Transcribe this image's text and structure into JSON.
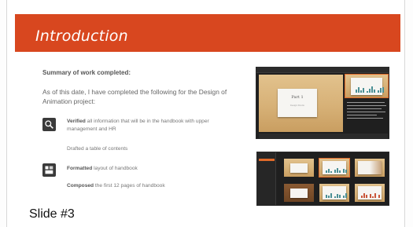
{
  "slide": {
    "title": "Introduction",
    "summary_heading": "Summary of work completed:",
    "intro": "As of this date, I have completed the following for the Design of Animation project:",
    "items": [
      {
        "bold": "Verified",
        "rest": " all information that will be in the handbook with upper management and HR",
        "icon": "search-icon"
      },
      {
        "bold": "",
        "rest": "Drafted a table of contents",
        "icon": ""
      },
      {
        "bold": "Formatted",
        "rest": " layout of handbook",
        "icon": "layout-icon"
      },
      {
        "bold": "Composed",
        "rest": " the first 12 pages of handbook",
        "icon": ""
      }
    ]
  },
  "screenshot_1": {
    "card_title": "Part 1",
    "card_subtitle": "Design Studio"
  },
  "caption": "Slide #3",
  "colors": {
    "accent": "#d8471f",
    "chart": "#4a8f94",
    "orange": "#e06a2a"
  }
}
